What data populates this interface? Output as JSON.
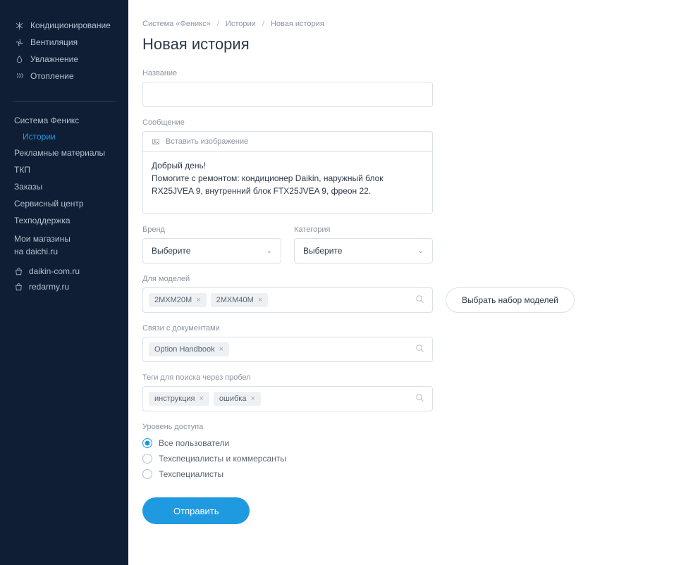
{
  "sidebar": {
    "top_items": [
      {
        "label": "Кондиционирование",
        "icon": "snowflake"
      },
      {
        "label": "Вентиляция",
        "icon": "fan"
      },
      {
        "label": "Увлажнение",
        "icon": "drop"
      },
      {
        "label": "Отопление",
        "icon": "heat"
      }
    ],
    "nav": {
      "phoenix": "Система Феникс",
      "phoenix_sub": "Истории",
      "items": [
        "Рекламные материалы",
        "ТКП",
        "Заказы",
        "Сервисный центр",
        "Техподдержка"
      ],
      "my_stores_1": "Мои магазины",
      "my_stores_2": "на daichi.ru",
      "external": [
        "daikin-com.ru",
        "redarmy.ru"
      ]
    }
  },
  "breadcrumb": {
    "a": "Система «Феникс»",
    "b": "Истории",
    "c": "Новая история"
  },
  "page_title": "Новая история",
  "labels": {
    "name": "Название",
    "message": "Сообщение",
    "insert_image": "Вставить изображение",
    "brand": "Бренд",
    "category": "Категория",
    "for_models": "Для моделей",
    "select_models_btn": "Выбрать набор моделей",
    "doc_links": "Связи с документами",
    "tags": "Теги для поиска через пробел",
    "access": "Уровень доступа",
    "submit": "Отправить"
  },
  "form": {
    "name_value": "",
    "message_value": "Добрый день!\nПомогите с ремонтом: кондиционер Daikin, наружный блок RX25JVEA 9, внутренний блок FTX25JVEA 9, фреон 22.",
    "brand_selected": "Выберите",
    "category_selected": "Выберите",
    "model_tags": [
      "2MXM20M",
      "2MXM40M"
    ],
    "doc_tags": [
      "Option Handbook"
    ],
    "search_tags": [
      "инструкция",
      "ошибка"
    ],
    "access_options": [
      "Все пользователи",
      "Техспециалисты и коммерсанты",
      "Техспециалисты"
    ],
    "access_selected_index": 0
  }
}
